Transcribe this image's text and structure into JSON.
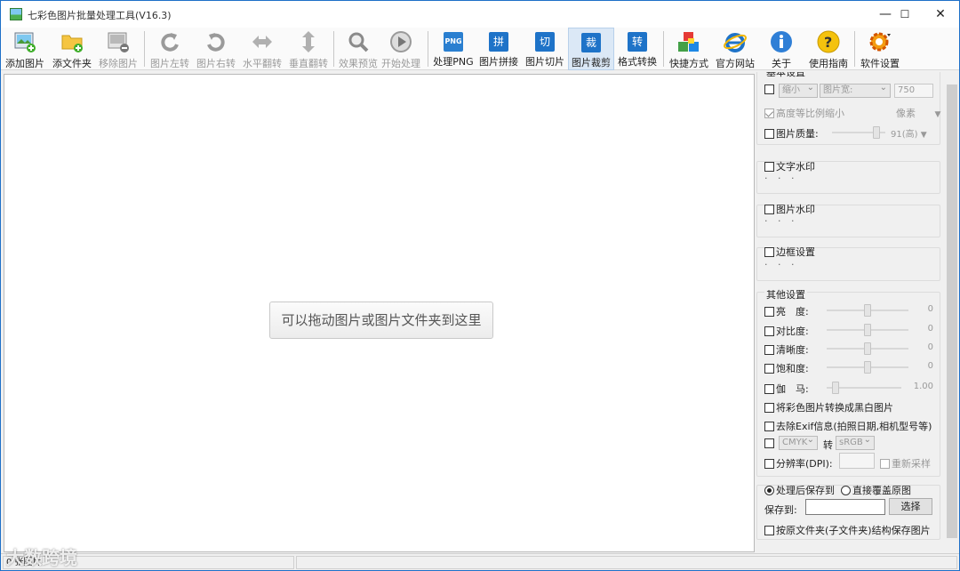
{
  "window": {
    "title": "七彩色图片批量处理工具(V16.3)",
    "minimize": "—",
    "maximize": "☐",
    "close": "✕"
  },
  "toolbar": {
    "add_image": "添加图片",
    "add_folder": "添文件夹",
    "remove_image": "移除图片",
    "rotate_left": "图片左转",
    "rotate_right": "图片右转",
    "flip_h": "水平翻转",
    "flip_v": "垂直翻转",
    "preview": "效果预览",
    "start": "开始处理",
    "process_png": "处理PNG",
    "png_badge": "PNG",
    "stitch": "图片拼接",
    "stitch_glyph": "拼",
    "slice": "图片切片",
    "slice_glyph": "切",
    "crop": "图片裁剪",
    "crop_glyph": "裁",
    "convert": "格式转换",
    "convert_glyph": "转",
    "shortcut": "快捷方式",
    "website": "官方网站",
    "about": "关于",
    "guide": "使用指南",
    "settings": "软件设置"
  },
  "main": {
    "drop_hint": "可以拖动图片或图片文件夹到这里"
  },
  "panel": {
    "basic": {
      "legend": "基本设置",
      "resize_mode": "缩小",
      "resize_by": "图片宽:",
      "width_value": "750",
      "keep_ratio": "高度等比例缩小",
      "unit": "像素",
      "quality_label": "图片质量:",
      "quality_value": "91(高)"
    },
    "text_watermark": {
      "label": "文字水印",
      "dots": "· · ·"
    },
    "image_watermark": {
      "label": "图片水印",
      "dots": "· · ·"
    },
    "border": {
      "label": "边框设置",
      "dots": "· · ·"
    },
    "other": {
      "legend": "其他设置",
      "brightness": "亮　度:",
      "brightness_val": "0",
      "contrast": "对比度:",
      "contrast_val": "0",
      "sharpness": "清晰度:",
      "sharpness_val": "0",
      "saturation": "饱和度:",
      "saturation_val": "0",
      "gamma": "伽　马:",
      "gamma_val": "1.00",
      "grayscale": "将彩色图片转换成黑白图片",
      "remove_exif": "去除Exif信息(拍照日期,相机型号等)",
      "cmyk_from": "CMYK",
      "cmyk_to_label": "转",
      "cmyk_to": "sRGB",
      "dpi_label": "分辨率(DPI):",
      "resample": "重新采样"
    },
    "save": {
      "save_after": "处理后保存到",
      "overwrite": "直接覆盖原图",
      "save_to_label": "保存到:",
      "choose": "选择",
      "keep_structure": "按原文件夹(子文件夹)结构保存图片"
    }
  },
  "status": {
    "count": "0 张图片"
  },
  "watermark_text": "大数跨境"
}
